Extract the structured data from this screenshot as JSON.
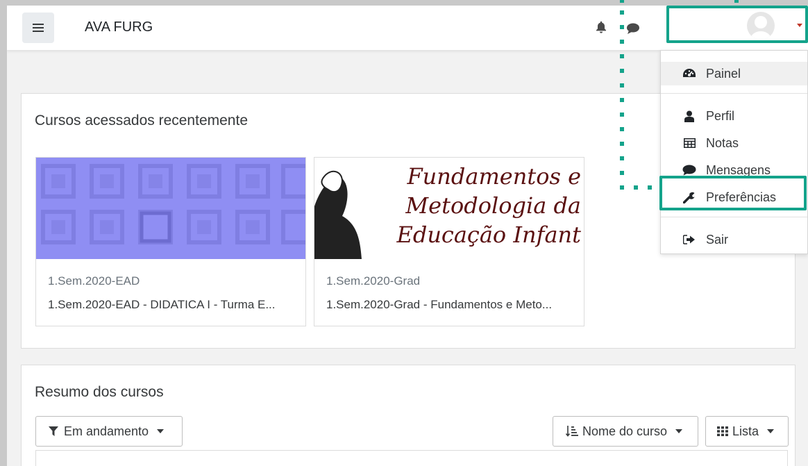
{
  "navbar": {
    "site_name": "AVA FURG",
    "icons": [
      "menu-icon",
      "bell-icon",
      "chat-icon",
      "avatar",
      "caret-down-icon"
    ]
  },
  "user_menu": {
    "items": [
      {
        "label": "Painel",
        "icon": "dashboard-icon"
      },
      {
        "label": "Perfil",
        "icon": "user-icon"
      },
      {
        "label": "Notas",
        "icon": "table-icon"
      },
      {
        "label": "Mensagens",
        "icon": "chat-icon"
      },
      {
        "label": "Preferências",
        "icon": "wrench-icon"
      },
      {
        "label": "Sair",
        "icon": "sign-out-icon"
      }
    ]
  },
  "recent": {
    "title": "Cursos acessados recentemente",
    "courses": [
      {
        "category": "1.Sem.2020-EAD",
        "name": "1.Sem.2020-EAD - DIDATICA I - Turma E..."
      },
      {
        "category": "1.Sem.2020-Grad",
        "name": "1.Sem.2020-Grad - Fundamentos e Meto...",
        "image_lines": [
          "Fundamentos e",
          "Metodologia da",
          "Educação Infant"
        ]
      }
    ]
  },
  "overview": {
    "title": "Resumo dos cursos",
    "filter_label": "Em andamento",
    "sort_label": "Nome do curso",
    "view_label": "Lista"
  },
  "colors": {
    "highlight": "#14a38b",
    "caret": "#c0392b",
    "course_pattern": "#8f8ef3"
  }
}
